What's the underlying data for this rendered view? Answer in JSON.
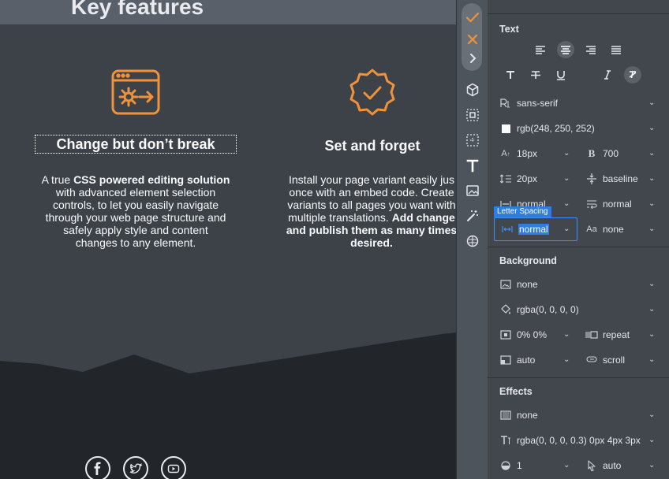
{
  "site": {
    "heading": "Key features",
    "features": [
      {
        "title": "Change but don’t break",
        "text_html": "A true <b>CSS powered editing solution</b> with advanced element selection controls, to let you easily navigate through your web page structure and safely apply style and content changes to any element."
      },
      {
        "title": "Set and forget",
        "text_html": "Install your page variant easily jus<br>once with an embed code. Create<br>variants to all pages you want with<br>multiple translations. <b>Add change</b><br><b>and publish them as many times</b><br><b>desired.</b>"
      }
    ],
    "social_icons": [
      "facebook-icon",
      "twitter-icon",
      "youtube-icon"
    ],
    "colors": {
      "accent": "#f0923a",
      "page_bg": "#3d4249",
      "footer_bg": "#22262b"
    }
  },
  "rail": {
    "buttons": [
      "check-icon",
      "close-icon",
      "chevron-right-icon",
      "cube-icon",
      "select-element-icon",
      "select-dashed-icon",
      "text-icon",
      "image-icon",
      "magic-wand-icon",
      "layers-icon"
    ]
  },
  "panel": {
    "text": {
      "title": "Text",
      "font_family": "sans-serif",
      "color": "rgb(248, 250, 252)",
      "font_size": "18px",
      "font_weight": "700",
      "line_height": "20px",
      "vertical_align": "baseline",
      "word_spacing": "normal",
      "white_space": "normal",
      "letter_spacing_tip": "Letter Spacing",
      "letter_spacing": "normal",
      "text_transform_label": "Aa",
      "text_transform": "none"
    },
    "background": {
      "title": "Background",
      "image": "none",
      "color": "rgba(0, 0, 0, 0)",
      "position": "0% 0%",
      "repeat": "repeat",
      "size": "auto",
      "attachment": "scroll"
    },
    "effects": {
      "title": "Effects",
      "filter": "none",
      "text_shadow": "rgba(0, 0, 0, 0.3) 0px 4px 3px",
      "opacity": "1",
      "cursor": "auto"
    }
  }
}
